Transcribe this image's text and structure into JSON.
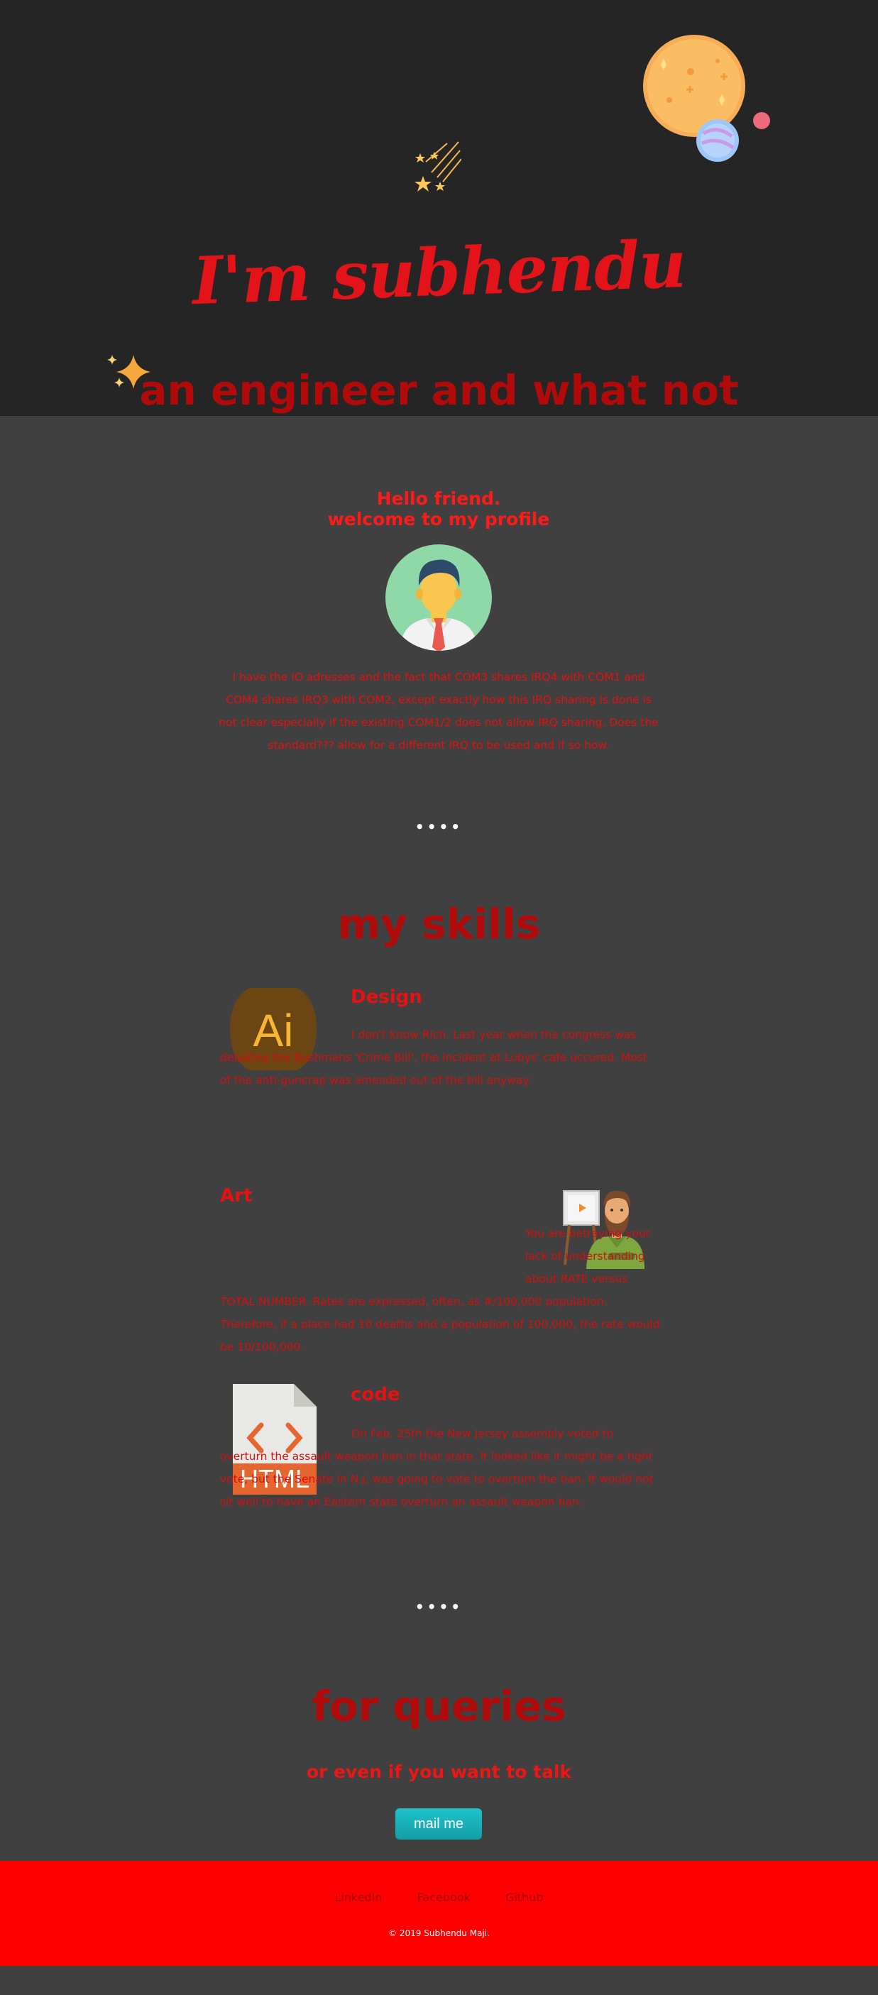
{
  "hero": {
    "title": "I'm subhendu",
    "subtitle": "an engineer and what not",
    "icons": [
      "planet-icon",
      "shooting-stars-icon",
      "sparkle-icon"
    ],
    "colors": {
      "background": "#252525",
      "title": "#e3131a",
      "subtitle": "#b00a0a"
    }
  },
  "profile": {
    "greeting_line1": "Hello friend.",
    "greeting_line2": "welcome to my profile",
    "avatar_icon": "businessman-avatar-icon",
    "intro": "I have the IO adresses and the fact that COM3 shares IRQ4 with COM1 and COM4 shares IRQ3 with COM2, except exactly how this IRQ sharing is done is not clear especially if the existing COM1/2 does not allow IRQ sharing. Does the standard??? allow for a different IRQ to be used and if so how."
  },
  "divider": "••••",
  "skills": {
    "title": "my skills",
    "items": [
      {
        "heading": "Design",
        "icon": "illustrator-ai-icon",
        "icon_text": "Ai",
        "text": "I don't know Rich. Last year when the congress was debating the Bushmans 'Crime Bill', the incident at Lubys' cafe occured. Most of the anti-guncrap was amended out of the bill anyway."
      },
      {
        "heading": "Art",
        "icon": "painter-easel-icon",
        "text": "You are betraying your lack of understanding about RATE versus TOTAL NUMBER. Rates are expressed, often, as #/100,000 population. Therefore, if a place had 10 deaths and a population of 100,000, the rate would be 10/100,000."
      },
      {
        "heading": "code",
        "icon": "html-file-icon",
        "icon_text": "HTML",
        "text": "On Feb. 25th the New Jersey assembly voted to overturn the assault weapon ban in that state. It looked like it might be a tight vote, but the Senate in N.J. was going to vote to overturn the ban. It would not sit well to have an Eastern state overturn an assault weapon ban."
      }
    ]
  },
  "contact": {
    "title": "for queries",
    "subtitle": "or even if you want to talk",
    "button": "mail me",
    "button_color": "#1bb3ba"
  },
  "footer": {
    "links": [
      "LinkedIn",
      "Facebook",
      "Github"
    ],
    "copyright": "© 2019 Subhendu Maji.",
    "color": "#ff0000"
  }
}
